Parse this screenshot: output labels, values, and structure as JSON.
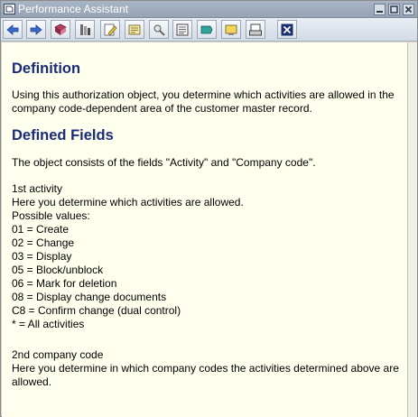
{
  "window": {
    "title": "Performance Assistant"
  },
  "toolbar": {
    "buttons": [
      {
        "id": "back",
        "icon": "arrow-left-icon"
      },
      {
        "id": "forward",
        "icon": "arrow-right-icon"
      },
      {
        "id": "book",
        "icon": "book-icon"
      },
      {
        "id": "technical-info",
        "icon": "technical-info-icon"
      },
      {
        "id": "edit",
        "icon": "edit-pencil-icon"
      },
      {
        "id": "glossary",
        "icon": "glossary-icon"
      },
      {
        "id": "find",
        "icon": "find-icon"
      },
      {
        "id": "document",
        "icon": "document-icon"
      },
      {
        "id": "notes",
        "icon": "notes-icon"
      },
      {
        "id": "settings",
        "icon": "settings-icon"
      },
      {
        "id": "print",
        "icon": "print-icon"
      },
      {
        "id": "close",
        "icon": "close-icon"
      }
    ]
  },
  "doc": {
    "definition_heading": "Definition",
    "definition_text": "Using this authorization object, you determine which activities are allowed in the company code-dependent area of the customer master record.",
    "fields_heading": "Defined Fields",
    "fields_intro": "The object consists of the fields \"Activity\" and \"Company code\".",
    "activity_title": "1st activity",
    "activity_desc": "Here you determine which activities are allowed.",
    "activity_values_label": "Possible values:",
    "activity_values": [
      "01 = Create",
      "02 = Change",
      "03 = Display",
      "05 = Block/unblock",
      "06 = Mark for deletion",
      "08 = Display change documents",
      "C8 = Confirm change (dual control)",
      "* = All activities"
    ],
    "company_title": "2nd company code",
    "company_desc": "Here you determine in which company codes the activities determined above are allowed."
  },
  "colors": {
    "content_bg": "#ffffee",
    "heading": "#1a2b78"
  }
}
